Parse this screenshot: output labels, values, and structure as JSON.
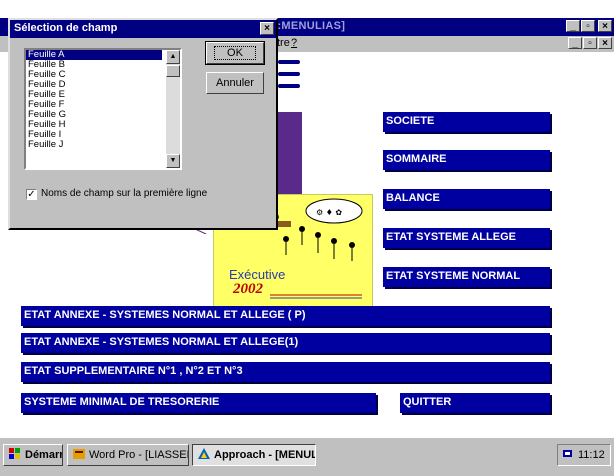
{
  "app": {
    "title": ":.APR:MENULIAS]",
    "menu": {
      "window": "tre",
      "help": "?"
    }
  },
  "dialog": {
    "title": "Sélection de champ",
    "close": "×",
    "list_items": [
      "Feuille A",
      "Feuille B",
      "Feuille C",
      "Feuille D",
      "Feuille E",
      "Feuille F",
      "Feuille G",
      "Feuille H",
      "Feuille I",
      "Feuille J"
    ],
    "selected_index": 0,
    "ok_label": "OK",
    "cancel_label": "Annuler",
    "checkbox_checked": true,
    "checkbox_mark": "✓",
    "checkbox_label": "Noms de champ sur la première ligne",
    "scroll_up": "▲",
    "scroll_down": "▼"
  },
  "logo": {
    "line1": "Exécutive",
    "line2": "2002"
  },
  "buttons": {
    "societe": "SOCIETE",
    "sommaire": "SOMMAIRE",
    "balance": "BALANCE",
    "etat_allege": "ETAT SYSTEME ALLEGE",
    "etat_normal": "ETAT SYSTEME NORMAL",
    "annexe_p": "ETAT ANNEXE - SYSTEMES NORMAL ET ALLEGE ( P)",
    "annexe_1": "ETAT ANNEXE - SYSTEMES NORMAL ET ALLEGE(1)",
    "supplementaire": "ETAT SUPPLEMENTAIRE N°1 , N°2 ET N°3",
    "tresorerie": "SYSTEME MINIMAL DE TRESORERIE",
    "quitter": "QUITTER"
  },
  "taskbar": {
    "start": "Démarrer",
    "task1": "Word Pro - [LIASSEFISCA...",
    "task2": "Approach - [MENULI...",
    "clock": "11:12"
  },
  "window_controls": {
    "minimize": "_",
    "restore": "▫",
    "close": "×"
  },
  "colors": {
    "accent_blue": "#0000a0",
    "titlebar": "#000080",
    "purple": "#5a2a8a",
    "logo_bg": "#ffff66"
  }
}
